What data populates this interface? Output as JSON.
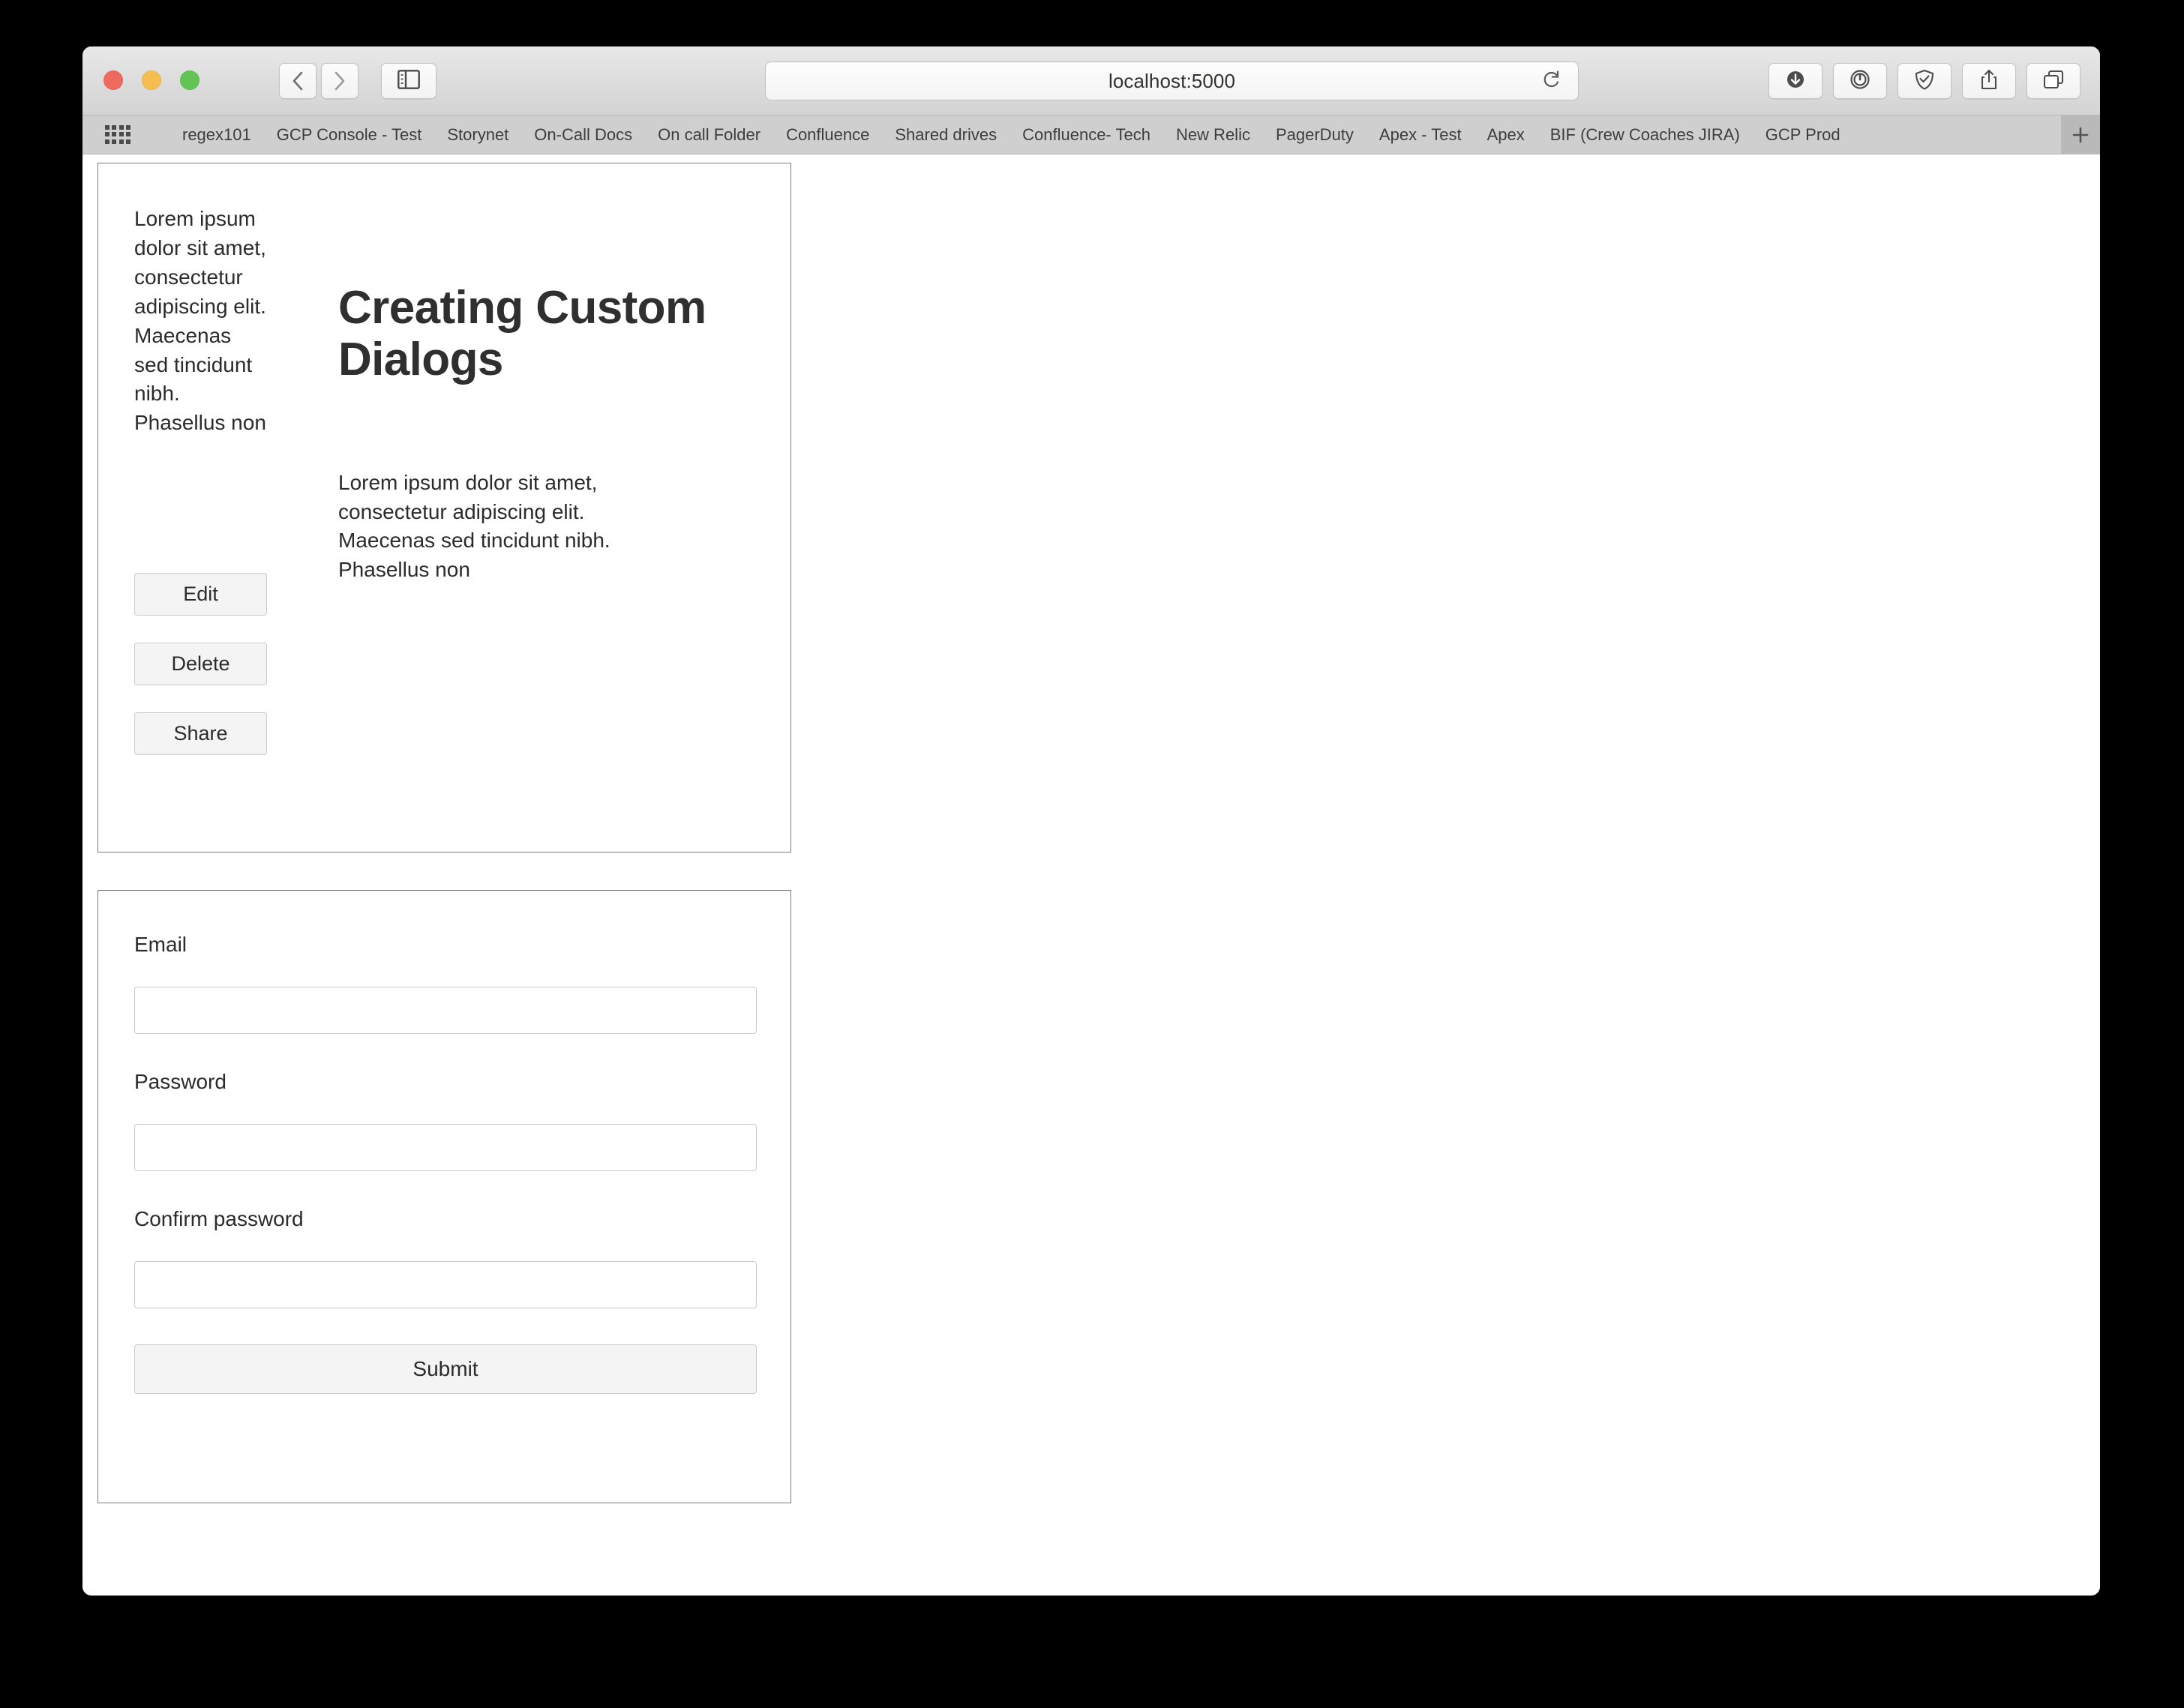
{
  "browser": {
    "url": "localhost:5000",
    "traffic_lights": [
      "close-button",
      "minimize-button",
      "zoom-button"
    ],
    "toolbar": {
      "back_icon": "chevron-left-icon",
      "forward_icon": "chevron-right-icon",
      "sidebar_icon": "sidebar-toggle-icon",
      "reload_icon": "reload-icon",
      "downloads_icon": "downloads-icon",
      "password_manager_icon": "1password-icon",
      "shield_icon": "shield-check-icon",
      "share_icon": "share-icon",
      "tabs_icon": "tab-overview-icon"
    },
    "bookmarks": {
      "grid_icon": "bookmarks-grid-icon",
      "add_label": "+",
      "items": [
        "regex101",
        "GCP Console - Test",
        "Storynet",
        "On-Call Docs",
        "On call Folder",
        "Confluence",
        "Shared drives",
        "Confluence- Tech",
        "New Relic",
        "PagerDuty",
        "Apex - Test",
        "Apex",
        "BIF (Crew Coaches JIRA)",
        "GCP Prod"
      ]
    }
  },
  "page": {
    "card_one": {
      "sidebar_text": "Lorem ipsum dolor sit amet, consectetur adipiscing elit. Maecenas sed tincidunt nibh. Phasellus non",
      "buttons": [
        {
          "label": "Edit",
          "name": "edit-button"
        },
        {
          "label": "Delete",
          "name": "delete-button"
        },
        {
          "label": "Share",
          "name": "share-button"
        }
      ],
      "heading": "Creating Custom Dialogs",
      "body": "Lorem ipsum dolor sit amet, consectetur adipiscing elit. Maecenas sed tincidunt nibh. Phasellus non"
    },
    "card_two": {
      "fields": [
        {
          "label": "Email",
          "value": "",
          "placeholder": "",
          "name": "email"
        },
        {
          "label": "Password",
          "value": "",
          "placeholder": "",
          "name": "password"
        },
        {
          "label": "Confirm password",
          "value": "",
          "placeholder": "",
          "name": "confirm-password"
        }
      ],
      "submit_label": "Submit"
    }
  },
  "colors": {
    "window_chrome": "#dcdcdc",
    "bookmarks_bar": "#cfcfcf",
    "card_border": "#7a7a7a",
    "input_border": "#cbcbcb",
    "button_face": "#f4f4f4",
    "text": "#2b2b2b",
    "heading": "#2f2f2f"
  }
}
